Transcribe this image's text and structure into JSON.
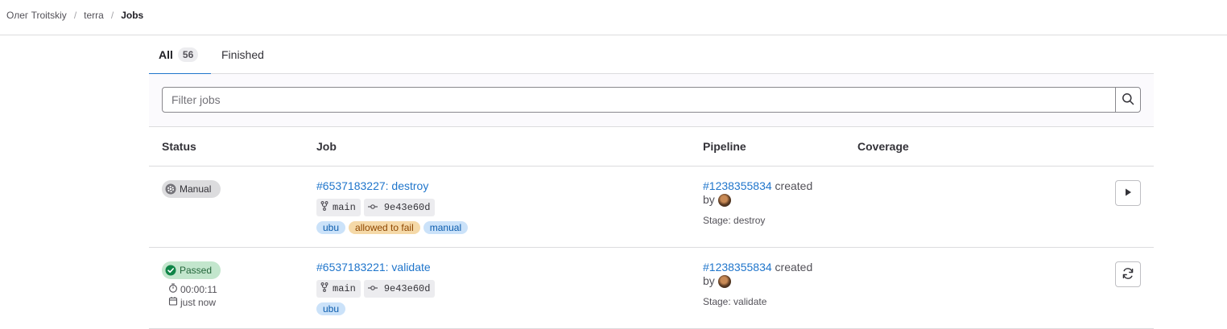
{
  "breadcrumb": [
    {
      "label": "Олег Troitskiy"
    },
    {
      "label": "terra"
    },
    {
      "label": "Jobs"
    }
  ],
  "breadcrumb_separator": "/",
  "tabs": [
    {
      "label": "All",
      "count": "56",
      "active": true
    },
    {
      "label": "Finished",
      "active": false
    }
  ],
  "filter": {
    "placeholder": "Filter jobs",
    "value": ""
  },
  "columns": [
    "Status",
    "Job",
    "Pipeline",
    "Coverage"
  ],
  "jobs": [
    {
      "status": "Manual",
      "status_icon": "gear-icon",
      "job_link": "#6537183227: destroy",
      "ref": "main",
      "commit": "9e43e60d",
      "tags": [
        "ubu",
        "allowed to fail",
        "manual"
      ],
      "pipeline_id": "#1238355834",
      "pipeline_created": "created",
      "pipeline_by": "by",
      "stage": "Stage: destroy",
      "action_icon": "play-icon"
    },
    {
      "status": "Passed",
      "status_icon": "check-circle-icon",
      "duration": "00:00:11",
      "finished": "just now",
      "job_link": "#6537183221: validate",
      "ref": "main",
      "commit": "9e43e60d",
      "tags": [
        "ubu"
      ],
      "pipeline_id": "#1238355834",
      "pipeline_created": "created",
      "pipeline_by": "by",
      "stage": "Stage: validate",
      "action_icon": "retry-icon"
    }
  ],
  "colors": {
    "link": "#1f75cb",
    "passed_bg": "#c3e6cd",
    "passed_icon": "#108548",
    "manual_bg": "#dcdcde",
    "tag_info_bg": "#cbe2f9",
    "tag_warning_bg": "#f5d9a8"
  }
}
